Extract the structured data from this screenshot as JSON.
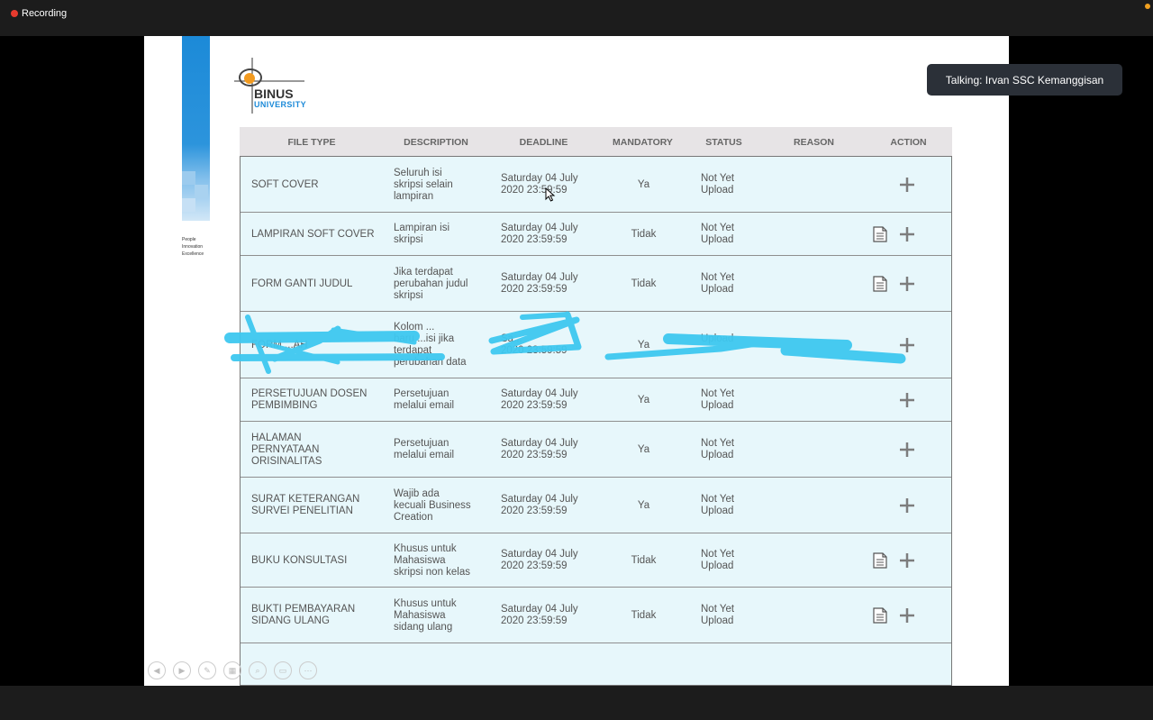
{
  "recording_label": "Recording",
  "talking_label": "Talking: Irvan SSC Kemanggisan",
  "logo": {
    "name": "BINUS",
    "sub": "UNIVERSITY"
  },
  "tagline": [
    "People",
    "Innovation",
    "Excellence"
  ],
  "headers": [
    "FILE TYPE",
    "DESCRIPTION",
    "DEADLINE",
    "MANDATORY",
    "STATUS",
    "REASON",
    "ACTION"
  ],
  "rows": [
    {
      "type": [
        "SOFT COVER"
      ],
      "desc": [
        "Seluruh isi",
        "skripsi selain",
        "lampiran"
      ],
      "deadline": [
        "Saturday 04 July",
        "2020 23:59:59"
      ],
      "mandatory": "Ya",
      "status": [
        "Not Yet",
        "Upload"
      ],
      "has_doc": false
    },
    {
      "type": [
        "LAMPIRAN SOFT COVER"
      ],
      "desc": [
        "Lampiran isi",
        "skripsi"
      ],
      "deadline": [
        "Saturday 04 July",
        "2020 23:59:59"
      ],
      "mandatory": "Tidak",
      "status": [
        "Not Yet",
        "Upload"
      ],
      "has_doc": true
    },
    {
      "type": [
        "FORM GANTI JUDUL"
      ],
      "desc": [
        "Jika terdapat",
        "perubahan judul",
        "skripsi"
      ],
      "deadline": [
        "Saturday 04 July",
        "2020 23:59:59"
      ],
      "mandatory": "Tidak",
      "status": [
        "Not Yet",
        "Upload"
      ],
      "has_doc": true
    },
    {
      "type": [
        "FORM ...AH"
      ],
      "desc": [
        "Kolom ...",
        "baru ...isi jika",
        "terdapat",
        "perubahan data"
      ],
      "deadline": [
        "Sa...",
        "2020 23:59:59"
      ],
      "mandatory": "Ya",
      "status": [
        "",
        "Upload"
      ],
      "has_doc": false
    },
    {
      "type": [
        "PERSETUJUAN DOSEN",
        "PEMBIMBING"
      ],
      "desc": [
        "Persetujuan",
        "melalui email"
      ],
      "deadline": [
        "Saturday 04 July",
        "2020 23:59:59"
      ],
      "mandatory": "Ya",
      "status": [
        "Not Yet",
        "Upload"
      ],
      "has_doc": false
    },
    {
      "type": [
        "HALAMAN",
        "PERNYATAAN",
        "ORISINALITAS"
      ],
      "desc": [
        "Persetujuan",
        "melalui email"
      ],
      "deadline": [
        "Saturday 04 July",
        "2020 23:59:59"
      ],
      "mandatory": "Ya",
      "status": [
        "Not Yet",
        "Upload"
      ],
      "has_doc": false
    },
    {
      "type": [
        "SURAT KETERANGAN",
        "SURVEI PENELITIAN"
      ],
      "desc": [
        "Wajib ada",
        "kecuali Business",
        "Creation"
      ],
      "deadline": [
        "Saturday 04 July",
        "2020 23:59:59"
      ],
      "mandatory": "Ya",
      "status": [
        "Not Yet",
        "Upload"
      ],
      "has_doc": false
    },
    {
      "type": [
        "BUKU KONSULTASI"
      ],
      "desc": [
        "Khusus untuk",
        "Mahasiswa",
        "skripsi non kelas"
      ],
      "deadline": [
        "Saturday 04 July",
        "2020 23:59:59"
      ],
      "mandatory": "Tidak",
      "status": [
        "Not Yet",
        "Upload"
      ],
      "has_doc": true
    },
    {
      "type": [
        "BUKTI PEMBAYARAN",
        "SIDANG ULANG"
      ],
      "desc": [
        "Khusus untuk",
        "Mahasiswa",
        "sidang ulang"
      ],
      "deadline": [
        "Saturday 04 July",
        "2020 23:59:59"
      ],
      "mandatory": "Tidak",
      "status": [
        "Not Yet",
        "Upload"
      ],
      "has_doc": true
    }
  ],
  "colors": {
    "table_bg": "#e7f7fb",
    "header_bg": "#e7e4e6",
    "brand_blue": "#1c8ad8",
    "scribble": "#3ec8f0"
  },
  "icons": {
    "doc": "document-icon",
    "add": "plus-icon"
  }
}
